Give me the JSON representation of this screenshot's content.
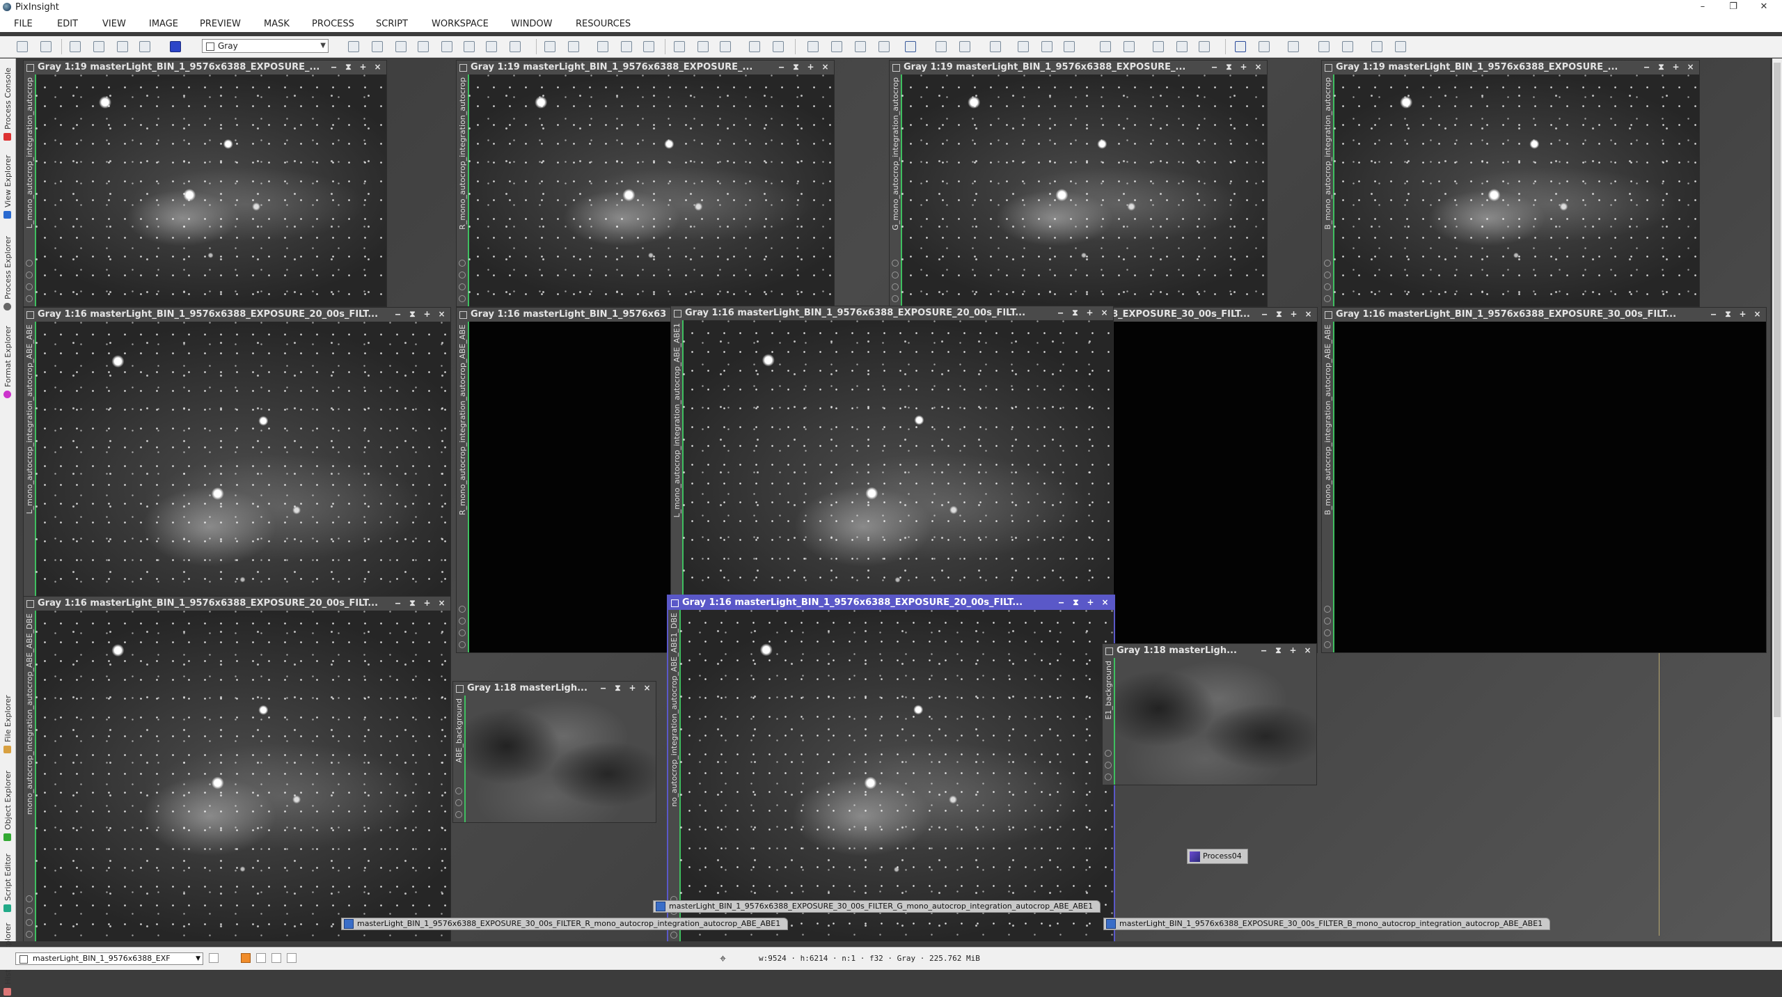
{
  "app": {
    "title": "PixInsight",
    "window_controls": [
      "–",
      "❐",
      "✕"
    ]
  },
  "menu": [
    "FILE",
    "EDIT",
    "VIEW",
    "IMAGE",
    "PREVIEW",
    "MASK",
    "PROCESS",
    "SCRIPT",
    "WORKSPACE",
    "WINDOW",
    "RESOURCES"
  ],
  "toolbar": {
    "colorspace": "Gray"
  },
  "left_dock": {
    "tabs": [
      "Process Console",
      "View Explorer",
      "Process Explorer",
      "Format Explorer",
      "File Explorer",
      "Object Explorer",
      "Script Editor",
      "History Explorer"
    ]
  },
  "win_controls": [
    "‒",
    "⧗",
    "+",
    "×"
  ],
  "windows": [
    {
      "title": "Gray 1:19 masterLight_BIN_1_9576x6388_EXPOSURE_...",
      "side": "L_mono_autocrop_integration_autocrop"
    },
    {
      "title": "Gray 1:19 masterLight_BIN_1_9576x6388_EXPOSURE_...",
      "side": "R_mono_autocrop_integration_autocrop"
    },
    {
      "title": "Gray 1:19 masterLight_BIN_1_9576x6388_EXPOSURE_...",
      "side": "G_mono_autocrop_integration_autocrop"
    },
    {
      "title": "Gray 1:19 masterLight_BIN_1_9576x6388_EXPOSURE_...",
      "side": "B_mono_autocrop_integration_autocrop"
    },
    {
      "title": "Gray 1:16 masterLight_BIN_1_9576x6388_EXPOSURE_20_00s_FILT...",
      "side": "L_mono_autocrop_integration_autocrop_ABE_ABE"
    },
    {
      "title": "Gray 1:16 masterLight_BIN_1_9576x63",
      "side": "R_mono_autocrop_integration_autocrop_ABE_ABE"
    },
    {
      "title": "Gray 1:16 masterLight_BIN_1_9576x6388_EXPOSURE_20_00s_FILT...",
      "side": "L_mono_autocrop_integration_autocrop_ABE_ABE1"
    },
    {
      "title": "88_EXPOSURE_30_00s_FILT...",
      "side": ""
    },
    {
      "title": "Gray 1:16 masterLight_BIN_1_9576x6388_EXPOSURE_30_00s_FILT...",
      "side": "B_mono_autocrop_integration_autocrop_ABE_ABE"
    },
    {
      "title": "Gray 1:16 masterLight_BIN_1_9576x6388_EXPOSURE_20_00s_FILT...",
      "side": "mono_autocrop_integration_autocrop_ABE_ABE_DBE"
    },
    {
      "title": "Gray 1:18 masterLigh...",
      "side": "ABE_background"
    },
    {
      "title": "Gray 1:16 masterLight_BIN_1_9576x6388_EXPOSURE_20_00s_FILT...",
      "side": "no_autocrop_integration_autocrop_ABE_ABE1_DBE"
    },
    {
      "title": "Gray 1:18 masterLigh...",
      "side": "E1_background"
    }
  ],
  "iconized": [
    "masterLight_BIN_1_9576x6388_EXPOSURE_30_00s_FILTER_G_mono_autocrop_integration_autocrop_ABE_ABE1",
    "masterLight_BIN_1_9576x6388_EXPOSURE_30_00s_FILTER_R_mono_autocrop_integration_autocrop_ABE_ABE1",
    "masterLight_BIN_1_9576x6388_EXPOSURE_30_00s_FILTER_B_mono_autocrop_integration_autocrop_ABE_ABE1"
  ],
  "process_icon": "Process04",
  "status": {
    "view": "masterLight_BIN_1_9576x6388_EXF",
    "info": "w:9524 · h:6214 · n:1 · f32 · Gray · 225.762 MiB"
  }
}
